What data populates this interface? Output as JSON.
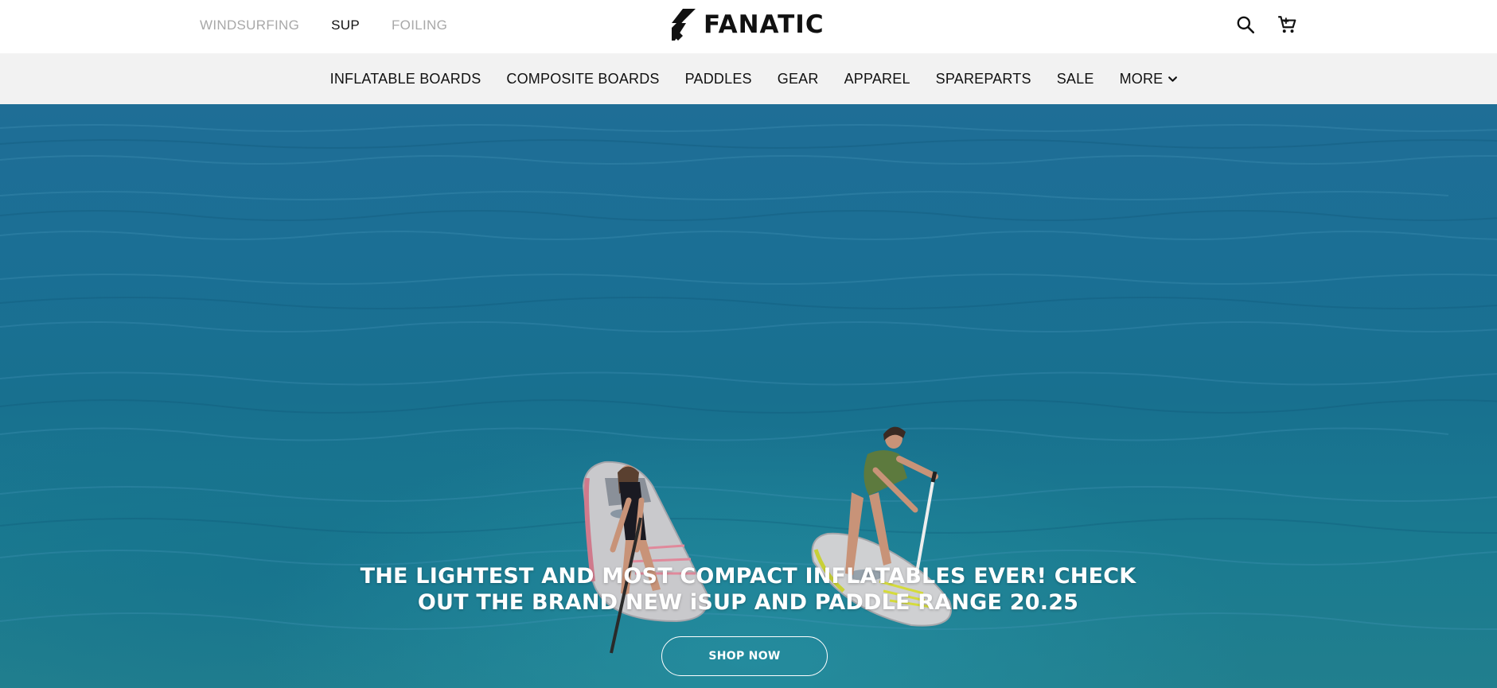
{
  "sport_switch": [
    {
      "label": "WINDSURFING",
      "active": false
    },
    {
      "label": "SUP",
      "active": true
    },
    {
      "label": "FOILING",
      "active": false
    }
  ],
  "brand": {
    "name": "FANATIC"
  },
  "top_actions": {
    "search_icon": "search-icon",
    "cart_icon": "cart-icon"
  },
  "nav": {
    "items": [
      {
        "label": "INFLATABLE BOARDS"
      },
      {
        "label": "COMPOSITE BOARDS"
      },
      {
        "label": "PADDLES"
      },
      {
        "label": "GEAR"
      },
      {
        "label": "APPAREL"
      },
      {
        "label": "SPAREPARTS"
      },
      {
        "label": "SALE"
      },
      {
        "label": "MORE"
      }
    ]
  },
  "hero": {
    "headline_line1": "THE LIGHTEST AND MOST COMPACT INFLATABLES EVER! CHECK",
    "headline_line2": "OUT THE BRAND NEW iSUP AND PADDLE RANGE 20.25",
    "cta_label": "SHOP NOW"
  },
  "colors": {
    "nav_bg": "#f2f2f2",
    "inactive_link": "#a8a8a8",
    "water": "#1b6f95"
  }
}
